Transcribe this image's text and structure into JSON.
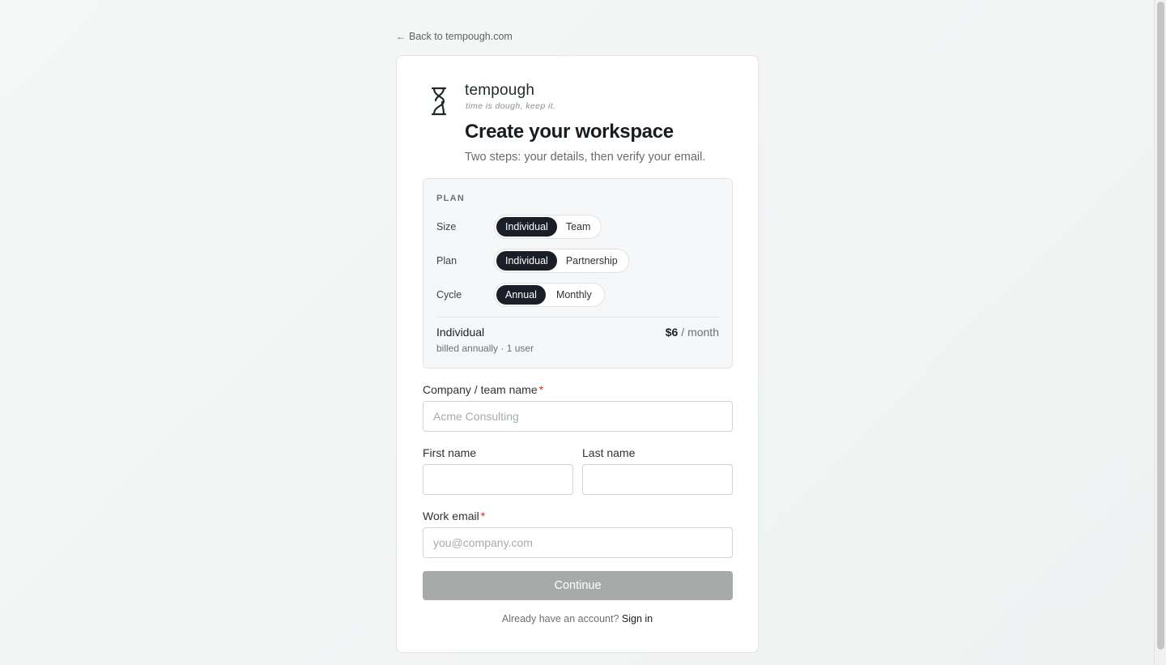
{
  "back_link": {
    "icon": "arrow-left-icon",
    "label": "Back to tempough.com"
  },
  "brand": {
    "logo_icon": "hourglass-dollar-logo",
    "name": "tempough",
    "tagline": "time is dough, keep it."
  },
  "header": {
    "title": "Create your workspace",
    "subtitle": "Two steps: your details, then verify your email."
  },
  "plan": {
    "heading": "PLAN",
    "rows": [
      {
        "label": "Size",
        "options": [
          "Individual",
          "Team"
        ],
        "selected": "Individual"
      },
      {
        "label": "Plan",
        "options": [
          "Individual",
          "Partnership"
        ],
        "selected": "Individual"
      },
      {
        "label": "Cycle",
        "options": [
          "Annual",
          "Monthly"
        ],
        "selected": "Annual"
      }
    ],
    "summary": {
      "name": "Individual",
      "detail": "billed annually · 1 user",
      "price": "$6",
      "period": "/ month"
    }
  },
  "form": {
    "company": {
      "label": "Company / team name",
      "required": "*",
      "placeholder": "Acme Consulting",
      "value": ""
    },
    "first_name": {
      "label": "First name",
      "placeholder": "",
      "value": ""
    },
    "last_name": {
      "label": "Last name",
      "placeholder": "",
      "value": ""
    },
    "email": {
      "label": "Work email",
      "required": "*",
      "placeholder": "you@company.com",
      "value": ""
    },
    "continue_label": "Continue"
  },
  "footer": {
    "prompt": "Already have an account?",
    "signin_label": "Sign in"
  },
  "colors": {
    "accent_dark": "#1a1e27",
    "button_disabled": "#a6aba9",
    "required": "#c0392b"
  }
}
